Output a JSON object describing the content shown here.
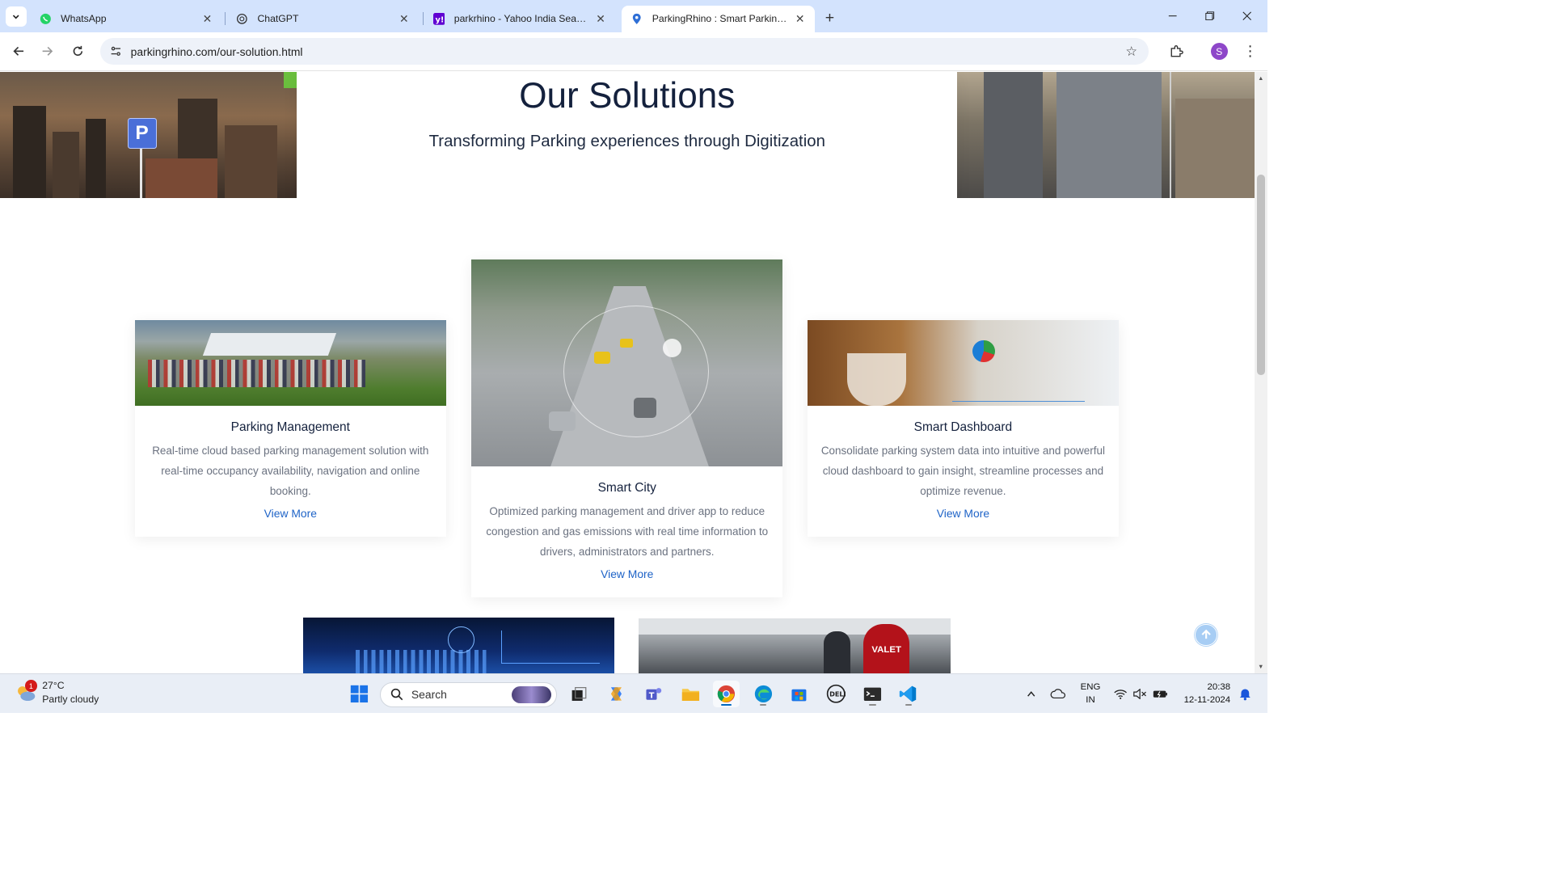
{
  "browser": {
    "tabs": [
      {
        "title": "WhatsApp",
        "icon": "whatsapp-icon",
        "active": false
      },
      {
        "title": "ChatGPT",
        "icon": "chatgpt-icon",
        "active": false
      },
      {
        "title": "parkrhino - Yahoo India Search",
        "icon": "yahoo-icon",
        "active": false
      },
      {
        "title": "ParkingRhino : Smart Parking in",
        "icon": "location-pin-icon",
        "active": true
      }
    ],
    "url": "parkingrhino.com/our-solution.html",
    "profile_initial": "S"
  },
  "hero": {
    "title": "Our Solutions",
    "subtitle": "Transforming Parking experiences through Digitization",
    "sign_letter": "P"
  },
  "cards": [
    {
      "title": "Parking Management",
      "description": "Real-time cloud based parking management solution with real-time occupancy availability, navigation and online booking.",
      "link": "View More"
    },
    {
      "title": "Smart City",
      "description": "Optimized parking management and driver app to reduce congestion and gas emissions with real time information to drivers, administrators and partners.",
      "link": "View More"
    },
    {
      "title": "Smart Dashboard",
      "description": "Consolidate parking system data into intuitive and powerful cloud dashboard to gain insight, streamline processes and optimize revenue.",
      "link": "View More"
    }
  ],
  "bottom_images": {
    "valet_text": "VALET"
  },
  "taskbar": {
    "weather": {
      "temp": "27°C",
      "condition": "Partly cloudy",
      "badge": "1"
    },
    "search_label": "Search",
    "lang_line1": "ENG",
    "lang_line2": "IN",
    "time": "20:38",
    "date": "12-11-2024"
  },
  "colors": {
    "tab_strip": "#d3e3fd",
    "link": "#1e63c7",
    "heading": "#14213d",
    "body_text": "#6b7280"
  }
}
